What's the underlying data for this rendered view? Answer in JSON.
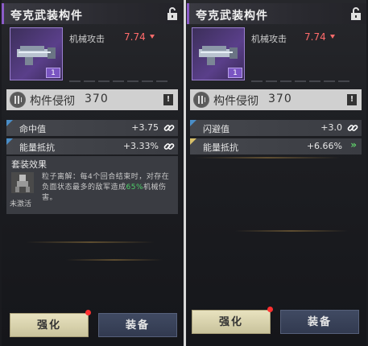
{
  "colors": {
    "accent_purple": "#8b5cc8",
    "negative": "#ff6b6b",
    "positive": "#4fd06a",
    "sub_blue": "#4a8ec8",
    "sub_gold": "#d8c06a"
  },
  "left": {
    "title": "夸克武装构件",
    "lock_icon": "unlock-icon",
    "badge": "1",
    "main_stat": {
      "label": "机械攻击",
      "value": "7.74"
    },
    "component": {
      "label": "构件侵彻",
      "value": "370",
      "warn": "!"
    },
    "attrs": [
      {
        "label": "命中值",
        "value": "+3.75",
        "icon": "link-icon"
      },
      {
        "label": "能量抵抗",
        "value": "+3.33%",
        "icon": "link-icon"
      }
    ],
    "set": {
      "title": "套装效果",
      "status": "未激活",
      "desc_pre": "粒子离解：每4个回合结束时，对存在负面状态最多的敌军造成",
      "desc_pct": "65%",
      "desc_post": "机械伤害。"
    },
    "buttons": {
      "upgrade": "强化",
      "equip": "装备"
    }
  },
  "right": {
    "title": "夸克武装构件",
    "lock_icon": "unlock-icon",
    "badge": "1",
    "main_stat": {
      "label": "机械攻击",
      "value": "7.74"
    },
    "component": {
      "label": "构件侵彻",
      "value": "370",
      "warn": "!"
    },
    "attrs": [
      {
        "label": "闪避值",
        "value": "+3.0",
        "icon": "link-icon"
      },
      {
        "label": "能量抵抗",
        "value": "+6.66%",
        "icon": "double-chevron-right-icon"
      }
    ],
    "buttons": {
      "upgrade": "强化",
      "equip": "装备"
    }
  }
}
